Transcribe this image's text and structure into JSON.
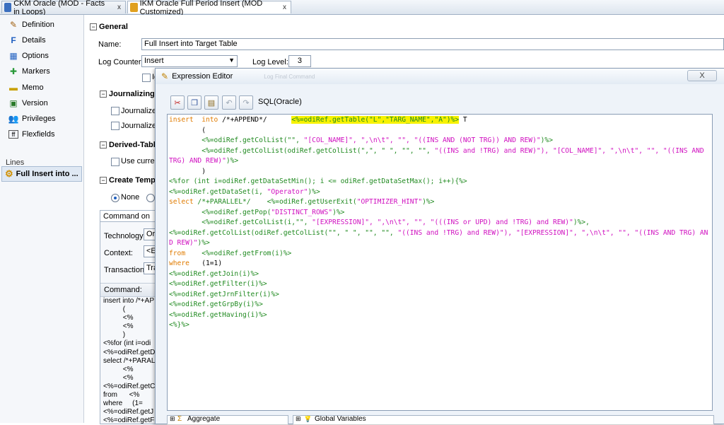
{
  "tabs": [
    {
      "label": "CKM Oracle (MOD - Facts in Loops)",
      "close": "x"
    },
    {
      "label": "IKM Oracle Full Period Insert (MOD Customized)",
      "close": "x"
    }
  ],
  "nav": {
    "items": [
      {
        "label": "Definition",
        "icon": "pencil-icon"
      },
      {
        "label": "Details",
        "icon": "details-icon"
      },
      {
        "label": "Options",
        "icon": "options-icon"
      },
      {
        "label": "Markers",
        "icon": "markers-icon"
      },
      {
        "label": "Memo",
        "icon": "memo-icon"
      },
      {
        "label": "Version",
        "icon": "version-icon"
      },
      {
        "label": "Privileges",
        "icon": "privileges-icon"
      },
      {
        "label": "Flexfields",
        "icon": "flexfields-icon"
      }
    ],
    "lines_label": "Lines",
    "line_item": "Full Insert into ..."
  },
  "general": {
    "section": "General",
    "name_label": "Name:",
    "name_value": "Full Insert into Target Table",
    "log_counter_label": "Log Counter:",
    "log_counter_value": "Insert",
    "log_level_label": "Log Level:",
    "log_level_value": "3",
    "ignore_label": "Ig"
  },
  "journalizing": {
    "section": "Journalizing",
    "opt1": "Journalized",
    "opt2": "Journalized"
  },
  "derived": {
    "section": "Derived-Table",
    "opt1": "Use current"
  },
  "create_temp": {
    "section": "Create Tempo",
    "none_label": "None"
  },
  "command_panel": {
    "tab": "Command on Tar",
    "technology_label": "Technology:",
    "technology_value": "Ora",
    "context_label": "Context:",
    "context_value": "<E",
    "transaction_label": "Transaction:",
    "transaction_value": "Tra",
    "command_label": "Command:",
    "command_lines": [
      "insert into /*+AP",
      "          (",
      "          <%",
      "          <%",
      "          )",
      "<%for (int i=odi",
      "<%=odiRef.getD",
      "select /*+PARAL",
      "          <%",
      "          <%",
      "<%=odiRef.getC",
      "from      <%",
      "where     (1=",
      "<%=odiRef.getJ",
      "<%=odiRef.getF"
    ]
  },
  "expression_editor": {
    "title": "Expression Editor",
    "title_ghost": "Log Final Command",
    "close": "X",
    "language": "SQL(Oracle)",
    "toolbar": [
      "cut-icon",
      "copy-icon",
      "paste-icon",
      "undo-icon",
      "redo-icon"
    ],
    "code": {
      "l1_kw": "insert  into",
      "l1_txt": " /*+APPEND*/      ",
      "l1_hl": "<%=odiRef.getTable(\"L\",\"TARG_NAME\",\"A\")%>",
      "l1_end": " T",
      "l2": "        (",
      "l3_a": "        <%=odiRef.getColList(\"\", ",
      "l3_s": "\"[COL_NAME]\", \",\\n\\t\", \"\", \"((INS AND (NOT TRG)) AND REW)\"",
      "l3_e": ")%>",
      "l4_a": "        <%=odiRef.getColList(odiRef.getColList(\",\", \" \", \"\", \"\", ",
      "l4_s": "\"((INS and !TRG) and REW)\"), \"[COL_NAME]\", \",\\n\\t\", \"\", \"((INS AND TRG) AND REW)\"",
      "l4_e": ")%>",
      "l5": "        )",
      "l6": "<%for (int i=odiRef.getDataSetMin(); i <= odiRef.getDataSetMax(); i++){%>",
      "l7_a": "<%=odiRef.getDataSet(i, ",
      "l7_s": "\"Operator\"",
      "l7_e": ")%>",
      "l8_kw": "select",
      "l8_txt": " /*+PARALLEL*/    <%=odiRef.getUserExit(",
      "l8_s": "\"OPTIMIZER_HINT\"",
      "l8_e": ")%>",
      "l9_a": "        <%=odiRef.getPop(",
      "l9_s": "\"DISTINCT_ROWS\"",
      "l9_e": ")%>",
      "l10_a": "        <%=odiRef.getColList(i,\"\", ",
      "l10_s": "\"[EXPRESSION]\", \",\\n\\t\", \"\", \"(((INS or UPD) and !TRG) and REW)\"",
      "l10_e": ")%>,",
      "l11_a": "<%=odiRef.getColList(odiRef.getColList(\"\", \" \", \"\", \"\", ",
      "l11_s": "\"((INS and !TRG) and REW)\"), \"[EXPRESSION]\", \",\\n\\t\", \"\", \"((INS AND TRG) AND REW)\"",
      "l11_e": ")%>",
      "l12_kw": "from",
      "l12_txt": "    <%=odiRef.getFrom(i)%>",
      "l13_kw": "where",
      "l13_txt": "   (1=1)",
      "l14": "<%=odiRef.getJoin(i)%>",
      "l15": "<%=odiRef.getFilter(i)%>",
      "l16": "<%=odiRef.getJrnFilter(i)%>",
      "l17": "<%=odiRef.getGrpBy(i)%>",
      "l18": "<%=odiRef.getHaving(i)%>",
      "l19": "<%}%>"
    },
    "bottom_left": "Aggregate",
    "bottom_right": "Global Variables"
  }
}
